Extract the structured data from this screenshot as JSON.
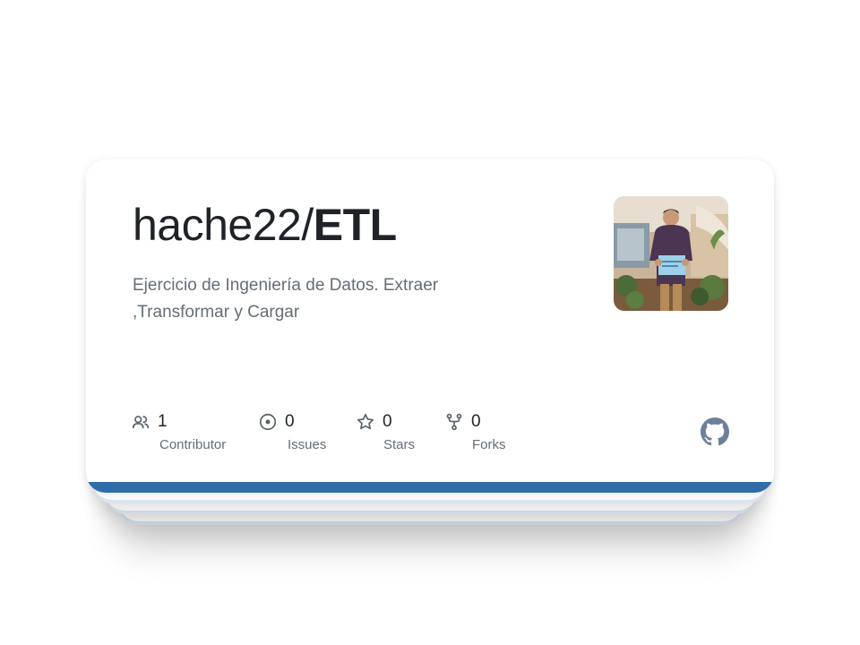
{
  "repo": {
    "owner_prefix": "hache22/",
    "name": "ETL",
    "description": "Ejercicio de Ingeniería de Datos. Extraer ,Transformar y Cargar"
  },
  "avatar": {
    "alt": "hache22"
  },
  "stats": [
    {
      "icon": "people-icon",
      "value": "1",
      "label": "Contributor"
    },
    {
      "icon": "issue-icon",
      "value": "0",
      "label": "Issues"
    },
    {
      "icon": "star-icon",
      "value": "0",
      "label": "Stars"
    },
    {
      "icon": "fork-icon",
      "value": "0",
      "label": "Forks"
    }
  ],
  "colors": {
    "accent_bar": "#2f6ca8",
    "title_text": "#1f2328",
    "muted_text": "#656d76",
    "github_logo": "#6e7f99"
  }
}
